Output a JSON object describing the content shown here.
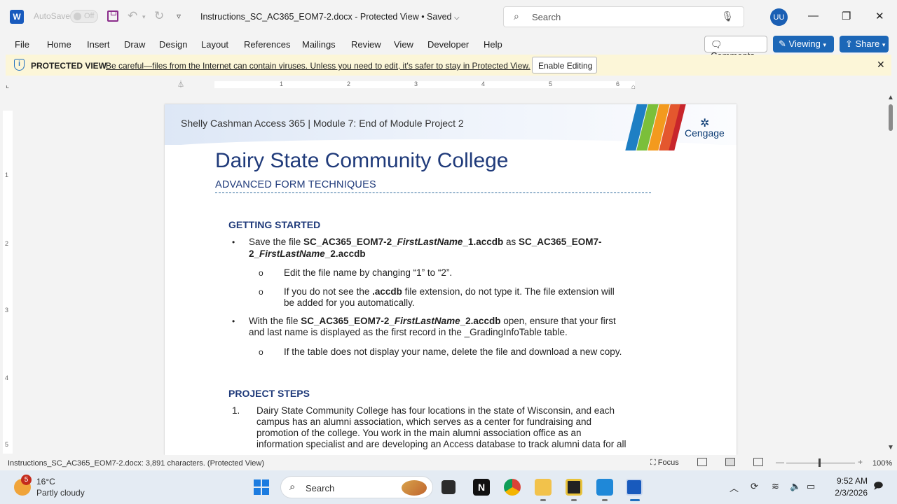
{
  "titlebar": {
    "autosave_label": "AutoSave",
    "autosave_state": "Off",
    "doc_title": "Instructions_SC_AC365_EOM7-2.docx  -  Protected View • Saved",
    "search_placeholder": "Search",
    "user_initials": "UU"
  },
  "ribbon": {
    "tabs": [
      "File",
      "Home",
      "Insert",
      "Draw",
      "Design",
      "Layout",
      "References",
      "Mailings",
      "Review",
      "View",
      "Developer",
      "Help"
    ],
    "comments": "Comments",
    "viewing": "Viewing",
    "share": "Share"
  },
  "protected_view": {
    "title": "PROTECTED VIEW",
    "message": "Be careful—files from the Internet can contain viruses. Unless you need to edit, it's safer to stay in Protected View.",
    "enable_button": "Enable Editing"
  },
  "ruler": {
    "h_numbers": [
      "1",
      "2",
      "3",
      "4",
      "5",
      "6"
    ],
    "v_numbers": [
      "1",
      "2",
      "3",
      "4",
      "5"
    ]
  },
  "document": {
    "banner_text": "Shelly Cashman Access 365  |  Module 7: End of Module Project 2",
    "cengage": "Cengage",
    "title": "Dairy State Community College",
    "subtitle": "ADVANCED FORM TECHNIQUES",
    "section1_heading": "GETTING STARTED",
    "b1_l1_pre": "Save the file ",
    "b1_l1_bold1": "SC_AC365_EOM7-2_",
    "b1_l1_it1": "FirstLastName",
    "b1_l1_bold2": "_1.accdb",
    "b1_l1_mid": " as ",
    "b1_l1_bold3": "SC_AC365_EOM7-",
    "b1_l2_bold1": "2_",
    "b1_l2_it1": "FirstLastName",
    "b1_l2_bold2": "_2.accdb",
    "sub1": "Edit the file name by changing “1” to “2”.",
    "sub2_pre": "If you do not see the ",
    "sub2_bold": ".accdb",
    "sub2_post": " file extension, do not type it. The file extension will",
    "sub2_l2": "be added for you automatically.",
    "b2_pre": "With the file ",
    "b2_bold1": "SC_AC365_EOM7-2_",
    "b2_it": "FirstLastName",
    "b2_bold2": "_2.accdb",
    "b2_post": " open, ensure that your first",
    "b2_l2": "and last name is displayed as the first record in the _GradingInfoTable table.",
    "sub3": "If the table does not display your name, delete the file and download a new copy.",
    "section2_heading": "PROJECT STEPS",
    "step1_num": "1.",
    "step1_l1": "Dairy State Community College has four locations in the state of Wisconsin, and each",
    "step1_l2": "campus has an alumni association, which serves as a center for fundraising and",
    "step1_l3": "promotion of the college. You work in the main alumni association office as an",
    "step1_l4": "information specialist and are developing an Access database to track alumni data for all"
  },
  "statusbar": {
    "info": "Instructions_SC_AC365_EOM7-2.docx: 3,891 characters.  (Protected View)",
    "focus": "Focus",
    "zoom": "100%"
  },
  "taskbar": {
    "weather_badge": "5",
    "temp": "16°C",
    "condition": "Partly cloudy",
    "search_label": "Search",
    "time": "9:52 AM",
    "date": "2/3/2026"
  },
  "colors": {
    "word_blue": "#185abd",
    "share_blue": "#1c67b7",
    "heading_navy": "#1f3a7a",
    "protected_bg": "#fcf6d8"
  }
}
